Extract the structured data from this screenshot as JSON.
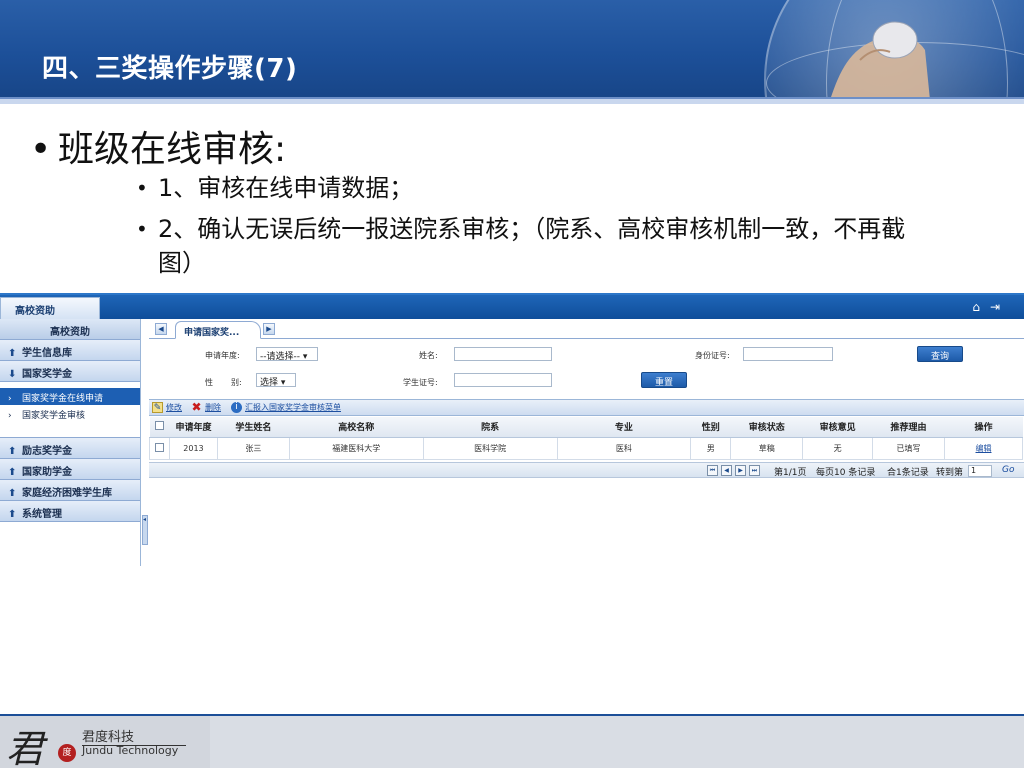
{
  "slide": {
    "title": "四、三奖操作步骤(7)",
    "bullet_l1": "班级在线审核:",
    "bullets_l2": [
      "1、审核在线申请数据；",
      "2、确认无误后统一报送院系审核；（院系、高校审核机制一致，不再截图）"
    ],
    "bullet_symbol": "•"
  },
  "app": {
    "top_tab": "高校资助",
    "header_icons": [
      "home-icon",
      "logout-icon"
    ],
    "sidebar": {
      "header": "高校资助",
      "groups": [
        {
          "label": "学生信息库",
          "icon": "arrow-up-icon"
        },
        {
          "label": "国家奖学金",
          "icon": "arrow-down-icon",
          "items": [
            {
              "label": "国家奖学金在线申请",
              "active": true
            },
            {
              "label": "国家奖学金审核",
              "active": false
            }
          ]
        },
        {
          "label": "励志奖学金",
          "icon": "arrow-up-icon"
        },
        {
          "label": "国家助学金",
          "icon": "arrow-up-icon"
        },
        {
          "label": "家庭经济困难学生库",
          "icon": "arrow-up-icon"
        },
        {
          "label": "系统管理",
          "icon": "arrow-up-icon"
        }
      ]
    },
    "main_tab": "申请国家奖...",
    "form": {
      "year_label": "申请年度:",
      "year_value": "--请选择--",
      "name_label": "姓名:",
      "id_label": "身份证号:",
      "gender_label_1": "性",
      "gender_label_2": "别:",
      "gender_value": "选择",
      "student_no_label": "学生证号:",
      "search_button": "查询",
      "reset_button": "重置"
    },
    "toolbar": {
      "edit": "修改",
      "delete": "删除",
      "submit": "汇报入国家奖学金审核菜单"
    },
    "grid": {
      "columns": [
        "申请年度",
        "学生姓名",
        "高校名称",
        "院系",
        "专业",
        "性别",
        "审核状态",
        "审核意见",
        "推荐理由",
        "操作"
      ],
      "rows": [
        [
          "2013",
          "张三",
          "福建医科大学",
          "医科学院",
          "医科",
          "男",
          "草稿",
          "无",
          "已填写",
          "编辑"
        ]
      ]
    },
    "pager": {
      "page_info": "第1/1页",
      "per_page": "每页10 条记录",
      "total": "合1条记录",
      "goto_label": "转到第",
      "goto_value": "1",
      "go": "Go"
    }
  },
  "footer": {
    "logo_mark": "君",
    "logo_seal": "度",
    "company_cn": "君度科技",
    "company_en": "Jundu Technology"
  },
  "colors": {
    "banner": "#1c4f98",
    "app_bar": "#1f66b8",
    "active_item": "#1d5fb3",
    "footer": "#d9dde4"
  }
}
